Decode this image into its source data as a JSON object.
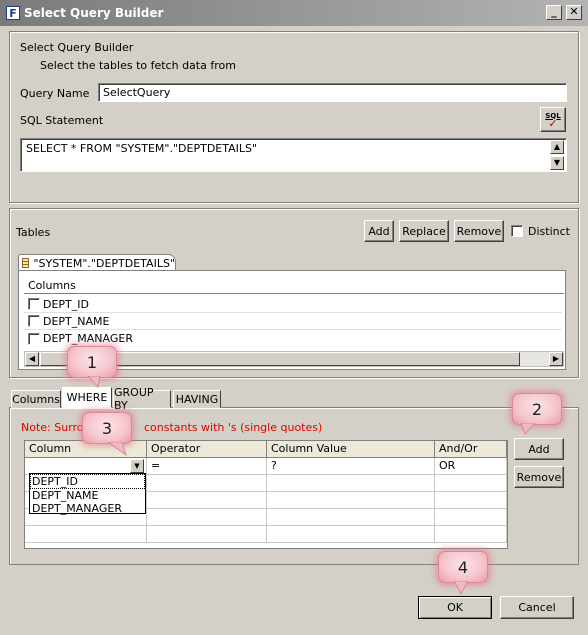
{
  "window": {
    "title": "Select Query Builder"
  },
  "header": {
    "heading": "Select Query Builder",
    "subheading": "Select the tables to fetch data from"
  },
  "query": {
    "name_label": "Query Name",
    "name_value": "SelectQuery",
    "sql_label": "SQL Statement",
    "sql_value": "SELECT * FROM \"SYSTEM\".\"DEPTDETAILS\"",
    "sql_icon_text": "SQL"
  },
  "tables": {
    "label": "Tables",
    "add": "Add",
    "replace": "Replace",
    "remove": "Remove",
    "distinct": "Distinct",
    "tab_name": "\"SYSTEM\".\"DEPTDETAILS\"",
    "columns_header": "Columns",
    "columns": [
      "DEPT_ID",
      "DEPT_NAME",
      "DEPT_MANAGER"
    ]
  },
  "clause_tabs": [
    "Columns",
    "WHERE",
    "GROUP BY",
    "HAVING"
  ],
  "where": {
    "note_left": "Note: Surrou",
    "note_right": "constants with 's (single quotes)",
    "headers": [
      "Column",
      "Operator",
      "Column Value",
      "And/Or"
    ],
    "row": {
      "column": "",
      "operator": "=",
      "value": "?",
      "andor": "OR"
    },
    "dropdown_options": [
      "DEPT_ID",
      "DEPT_NAME",
      "DEPT_MANAGER"
    ],
    "add": "Add",
    "remove": "Remove"
  },
  "footer": {
    "ok": "OK",
    "cancel": "Cancel"
  },
  "callouts": [
    "1",
    "2",
    "3",
    "4"
  ],
  "colors": {
    "note": "#e00000",
    "callout": "#f5c4cc"
  }
}
